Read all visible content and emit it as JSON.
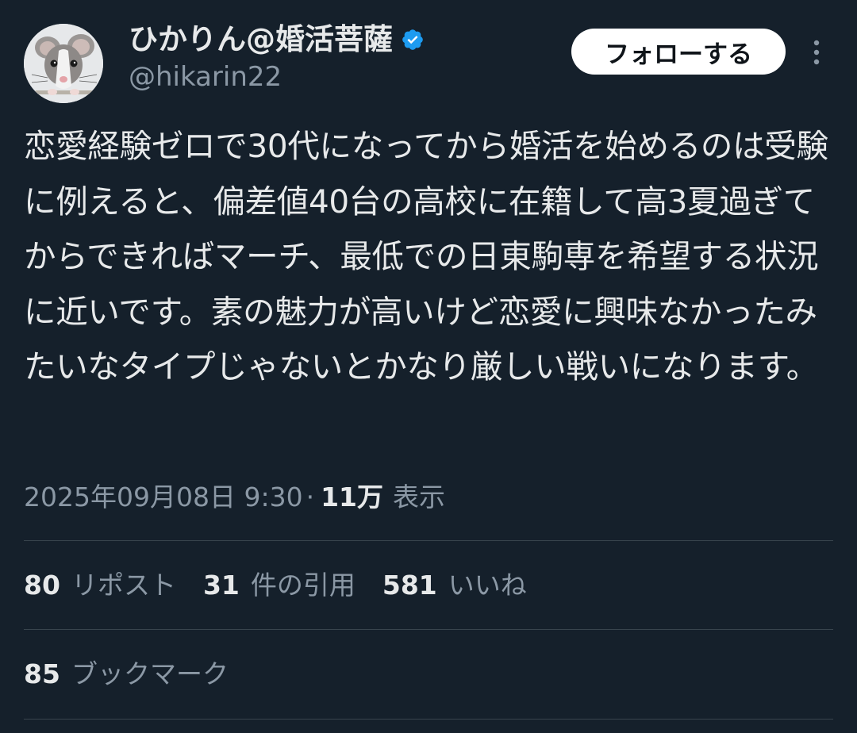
{
  "author": {
    "display_name": "ひかりん@婚活菩薩",
    "handle": "@hikarin22",
    "verified": true,
    "avatar_icon": "rat-avatar-icon"
  },
  "actions": {
    "follow_label": "フォローする",
    "more_icon": "more-vertical-icon"
  },
  "tweet": {
    "text": "恋愛経験ゼロで30代になってから婚活を始めるのは受験に例えると、偏差値40台の高校に在籍して高3夏過ぎてからできればマーチ、最低での日東駒専を希望する状況に近いです。素の魅力が高いけど恋愛に興味なかったみたいなタイプじゃないとかなり厳しい戦いになります。",
    "date": "2025年09月08日 9:30",
    "separator": "·",
    "views_count": "11万",
    "views_label": "表示"
  },
  "stats": {
    "reposts_count": "80",
    "reposts_label": "リポスト",
    "quotes_count": "31",
    "quotes_label": "件の引用",
    "likes_count": "581",
    "likes_label": "いいね",
    "bookmarks_count": "85",
    "bookmarks_label": "ブックマーク"
  },
  "colors": {
    "background": "#15202b",
    "text_primary": "#e7e9ea",
    "text_secondary": "#8b98a5",
    "divider": "#38444d",
    "verified_blue": "#1d9bf0"
  }
}
